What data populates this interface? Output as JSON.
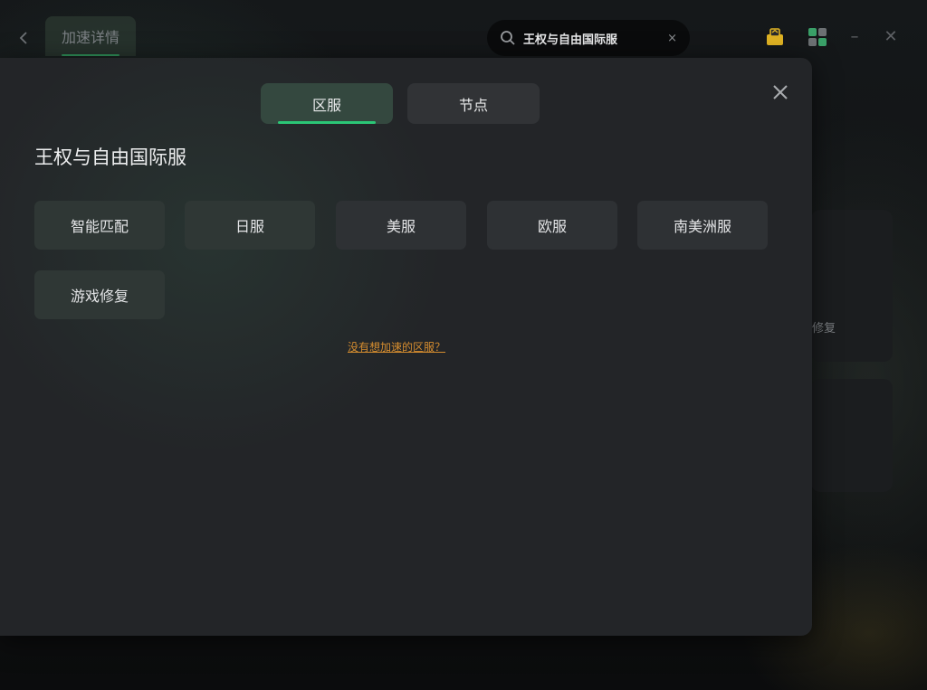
{
  "topbar": {
    "back_icon": "chevron-left-icon",
    "title": "加速详情",
    "search": {
      "value": "王权与自由国际服",
      "clear_label": "×"
    },
    "icons": [
      "gift-box-icon",
      "apps-grid-icon"
    ],
    "minimize_label": "–",
    "close_label": "✕"
  },
  "background": {
    "card_partial_text": "修复"
  },
  "modal": {
    "tabs": [
      {
        "label": "区服",
        "active": true
      },
      {
        "label": "节点",
        "active": false
      }
    ],
    "close_icon": "close-icon",
    "game_title": "王权与自由国际服",
    "servers": [
      {
        "label": "智能匹配"
      },
      {
        "label": "日服"
      },
      {
        "label": "美服"
      },
      {
        "label": "欧服"
      },
      {
        "label": "南美洲服"
      },
      {
        "label": "游戏修复"
      }
    ],
    "help_link": "没有想加速的区服？"
  },
  "colors": {
    "accent_green": "#2bc676",
    "link_orange": "#d48c2f",
    "modal_bg": "#232528",
    "button_bg": "#2e3134"
  }
}
